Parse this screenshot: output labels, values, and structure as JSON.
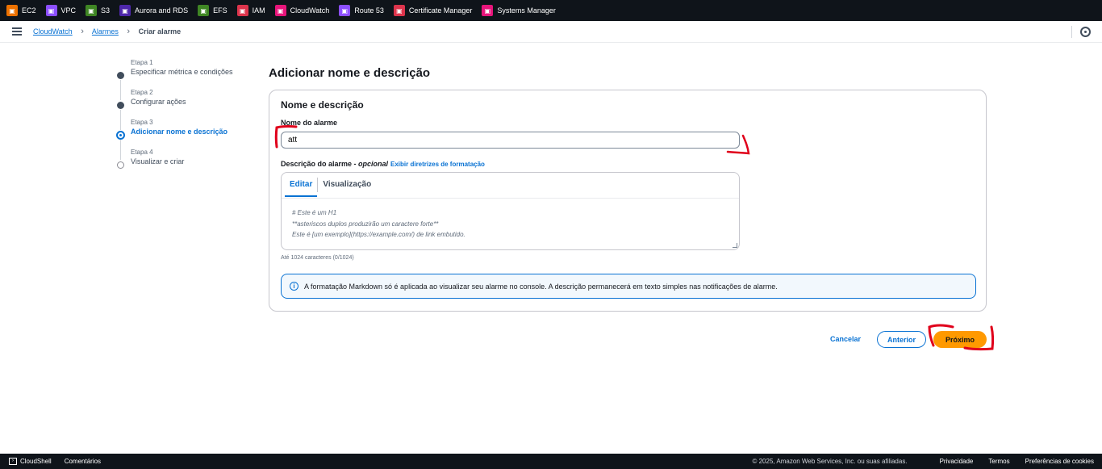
{
  "services": [
    {
      "label": "EC2",
      "icon": "ec2-icon",
      "color": "#ed7100"
    },
    {
      "label": "VPC",
      "icon": "vpc-icon",
      "color": "#8c4fff"
    },
    {
      "label": "S3",
      "icon": "s3-icon",
      "color": "#3f8624"
    },
    {
      "label": "Aurora and RDS",
      "icon": "rds-icon",
      "color": "#4d27aa"
    },
    {
      "label": "EFS",
      "icon": "efs-icon",
      "color": "#3f8624"
    },
    {
      "label": "IAM",
      "icon": "iam-icon",
      "color": "#dd344c"
    },
    {
      "label": "CloudWatch",
      "icon": "cloudwatch-icon",
      "color": "#e7157b"
    },
    {
      "label": "Route 53",
      "icon": "route53-icon",
      "color": "#8c4fff"
    },
    {
      "label": "Certificate Manager",
      "icon": "certificate-manager-icon",
      "color": "#dd344c"
    },
    {
      "label": "Systems Manager",
      "icon": "systems-manager-icon",
      "color": "#e7157b"
    }
  ],
  "breadcrumb": {
    "root": "CloudWatch",
    "section": "Alarmes",
    "current": "Criar alarme"
  },
  "steps": [
    {
      "label": "Etapa 1",
      "title": "Especificar métrica e condições",
      "state": "complete"
    },
    {
      "label": "Etapa 2",
      "title": "Configurar ações",
      "state": "complete"
    },
    {
      "label": "Etapa 3",
      "title": "Adicionar nome e descrição",
      "state": "active"
    },
    {
      "label": "Etapa 4",
      "title": "Visualizar e criar",
      "state": "pending"
    }
  ],
  "page": {
    "title": "Adicionar nome e descrição"
  },
  "panel": {
    "title": "Nome e descrição",
    "name_label": "Nome do alarme",
    "name_value": "att",
    "desc_label": "Descrição do alarme - ",
    "desc_optional": "opcional",
    "desc_link": "Exibir diretrizes de formatação",
    "tabs": [
      "Editar",
      "Visualização"
    ],
    "placeholder_lines": [
      "# Este é um H1",
      "**asteriscos duplos produzirão um caractere forte**",
      "Este é [um exemplo](https://example.com/) de link embutido."
    ],
    "char_hint": "Até 1024 caracteres (0/1024)",
    "info": "A formatação Markdown só é aplicada ao visualizar seu alarme no console. A descrição permanecerá em texto simples nas notificações de alarme."
  },
  "actions": {
    "cancel": "Cancelar",
    "previous": "Anterior",
    "next": "Próximo"
  },
  "footer": {
    "cloudshell": "CloudShell",
    "comments": "Comentários",
    "copyright": "© 2025, Amazon Web Services, Inc. ou suas afiliadas.",
    "privacy": "Privacidade",
    "terms": "Termos",
    "cookies": "Preferências de cookies"
  },
  "colors": {
    "accent": "#0972d3",
    "primary_button": "#ff9900",
    "annotation": "#e0001b"
  }
}
